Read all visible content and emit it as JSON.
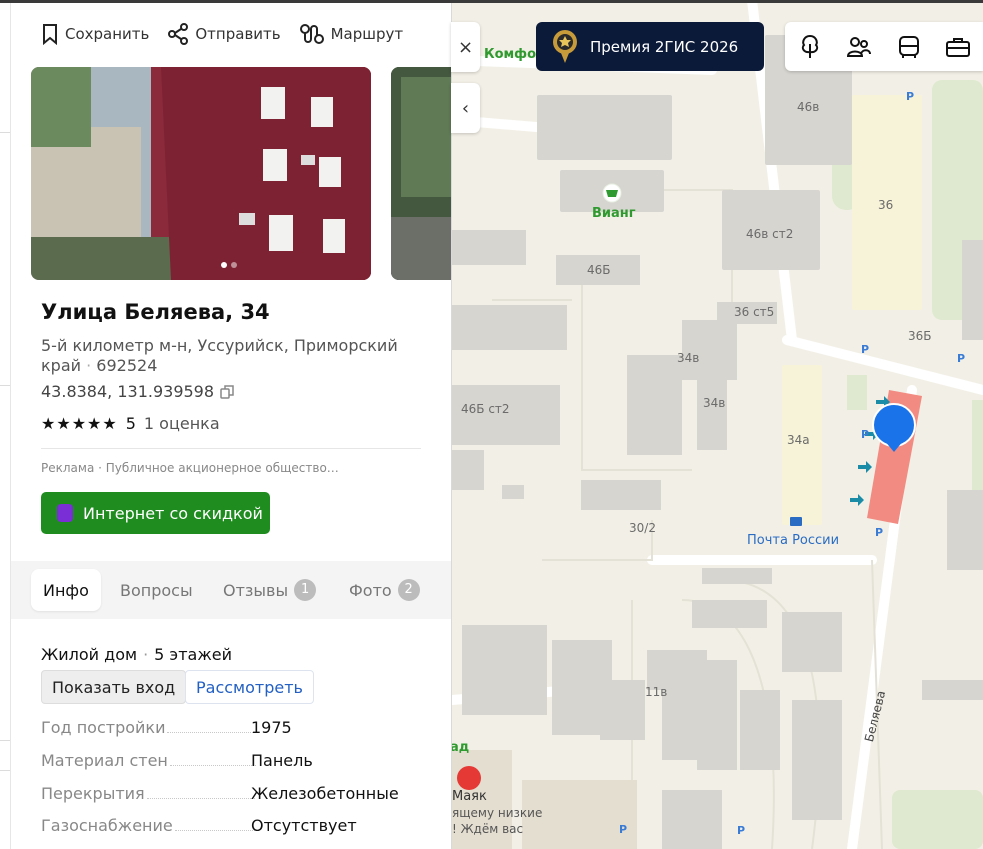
{
  "card": {
    "actions": [
      {
        "label": "Сохранить",
        "icon": "bookmark-icon"
      },
      {
        "label": "Отправить",
        "icon": "share-icon"
      },
      {
        "label": "Маршрут",
        "icon": "route-icon"
      }
    ],
    "title": "Улица Беляева, 34",
    "address": "5-й километр м-н, Уссурийск, Приморский край",
    "postcode": "692524",
    "coords": "43.8384, 131.939598",
    "rating": {
      "stars": "★★★★★",
      "value": "5",
      "count_label": "1 оценка"
    },
    "ad": {
      "text": "Реклама · Публичное акционерное общество…",
      "button_label": "Интернет со скидкой",
      "accent": "#1f8c1f"
    },
    "tabs": [
      {
        "label": "Инфо"
      },
      {
        "label": "Вопросы"
      },
      {
        "label": "Отзывы",
        "badge": "1"
      },
      {
        "label": "Фото",
        "badge": "2"
      }
    ],
    "building": {
      "type": "Жилой дом",
      "floors": "5 этажей",
      "show_entrance": "Показать вход",
      "view": "Рассмотреть"
    },
    "props": [
      {
        "key": "Год постройки",
        "value": "1975"
      },
      {
        "key": "Материал стен",
        "value": "Панель"
      },
      {
        "key": "Перекрытия",
        "value": "Железобетонные"
      },
      {
        "key": "Газоснабжение",
        "value": "Отсутствует"
      }
    ]
  },
  "map": {
    "close_label": "×",
    "collapse_label": "‹",
    "premium_label": "Премия 2ГИС 2026",
    "labels": {
      "b46v": "46в",
      "b36": "36",
      "b46vst2": "46в ст2",
      "b46b": "46Б",
      "b36st5": "36 ст5",
      "b36b": "36Б",
      "b34v": "34в",
      "b34v2": "34в",
      "b46bst2": "46Б ст2",
      "b34a": "34а",
      "b30_2": "30/2",
      "b11v": "11в"
    },
    "pois": {
      "viang": "Вианг",
      "komfo": "Комфо",
      "post": "Почта России",
      "mayak": "Маяк",
      "mayak_sub1": "ящему низкие",
      "mayak_sub2": "! Ждём вас",
      "ad": "ад"
    },
    "street": "Беляева",
    "p_marker": "P",
    "colors": {
      "accent_pin": "#1a73e8",
      "highlight": "#f28b82",
      "premium_bg": "#0c1a3a"
    }
  }
}
